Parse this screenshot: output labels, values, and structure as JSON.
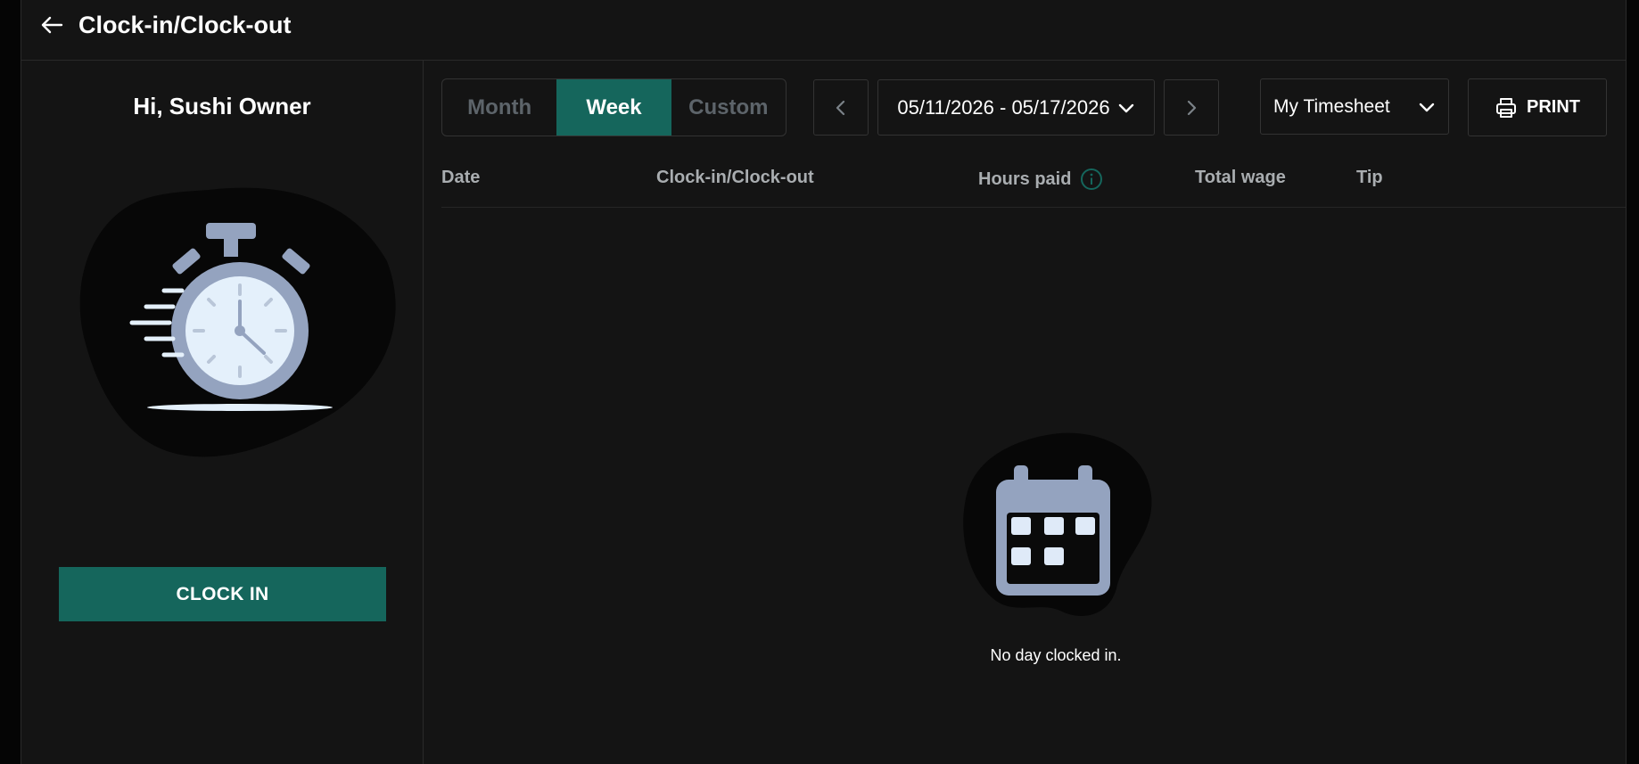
{
  "header": {
    "title": "Clock-in/Clock-out",
    "back_icon": "arrow-left-icon"
  },
  "left_panel": {
    "greeting": "Hi, Sushi Owner",
    "illustration": "stopwatch-icon",
    "clock_in_label": "CLOCK IN"
  },
  "toolbar": {
    "view_options": [
      {
        "label": "Month",
        "active": false
      },
      {
        "label": "Week",
        "active": true
      },
      {
        "label": "Custom",
        "active": false
      }
    ],
    "prev_icon": "chevron-left-icon",
    "next_icon": "chevron-right-icon",
    "date_range": "05/11/2026 - 05/17/2026",
    "timesheet_select": "My Timesheet",
    "print_label": "PRINT",
    "print_icon": "printer-icon"
  },
  "table": {
    "columns": [
      "Date",
      "Clock-in/Clock-out",
      "Hours paid",
      "Total wage",
      "Tip"
    ],
    "info_icon": "info-icon",
    "rows": []
  },
  "empty_state": {
    "icon": "calendar-icon",
    "message": "No day clocked in."
  },
  "colors": {
    "accent": "#15665c",
    "background": "#141414",
    "illustration": "#94a3bf"
  }
}
